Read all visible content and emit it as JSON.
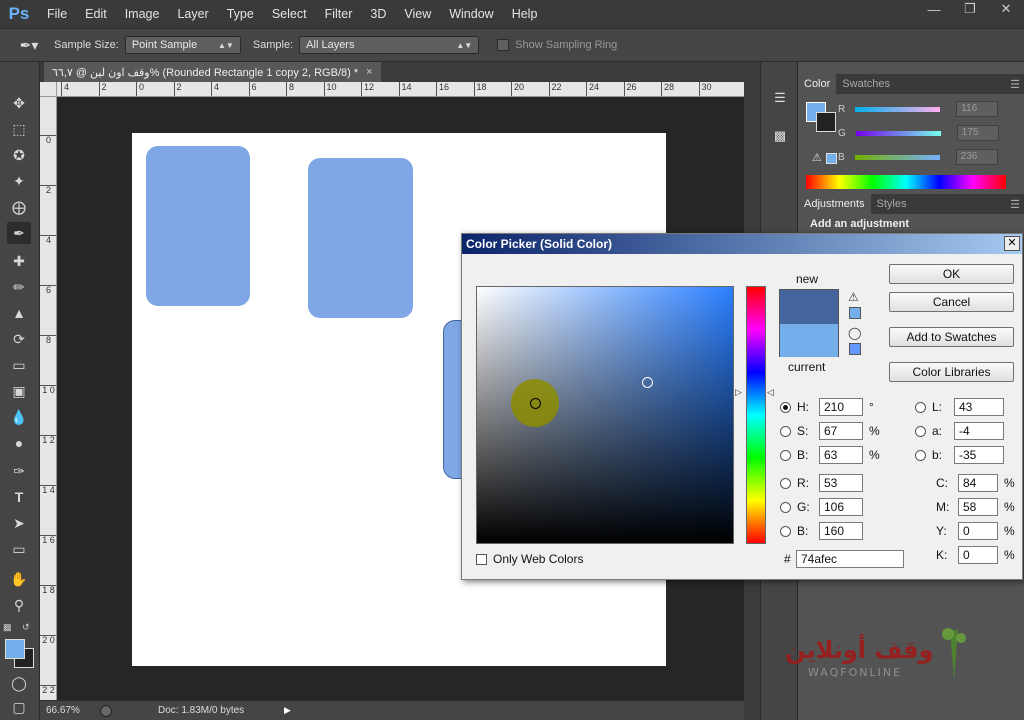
{
  "app": {
    "logo": "Ps",
    "menu": [
      "File",
      "Edit",
      "Image",
      "Layer",
      "Type",
      "Select",
      "Filter",
      "3D",
      "View",
      "Window",
      "Help"
    ]
  },
  "options_bar": {
    "sample_size_label": "Sample Size:",
    "sample_size_value": "Point Sample",
    "sample_label": "Sample:",
    "sample_value": "All Layers",
    "show_ring_label": "Show Sampling Ring"
  },
  "document": {
    "tab_title": "وقف اون لين @ ٦٦,٧% (Rounded Rectangle 1 copy 2, RGB/8) *",
    "ruler_h": [
      "4",
      "2",
      "0",
      "2",
      "4",
      "6",
      "8",
      "10",
      "12",
      "14",
      "16",
      "18",
      "20",
      "22",
      "24",
      "26",
      "28",
      "30"
    ],
    "ruler_v": [
      "0",
      "2",
      "4",
      "6",
      "8",
      "1 0",
      "1 2",
      "1 4",
      "1 6",
      "1 8",
      "2 0",
      "2 2"
    ],
    "shape_color": "#7fa7e6"
  },
  "status": {
    "zoom": "66.67%",
    "doc_info": "Doc: 1.83M/0 bytes"
  },
  "color_panel": {
    "tabs": [
      "Color",
      "Swatches"
    ],
    "channels": [
      {
        "label": "R",
        "value": "116"
      },
      {
        "label": "G",
        "value": "175"
      },
      {
        "label": "B",
        "value": "236"
      }
    ]
  },
  "adjustments_panel": {
    "tabs": [
      "Adjustments",
      "Styles"
    ],
    "heading": "Add an adjustment"
  },
  "color_picker": {
    "title": "Color Picker (Solid Color)",
    "new_label": "new",
    "current_label": "current",
    "new_color": "#44659e",
    "current_color": "#74afec",
    "buttons": {
      "ok": "OK",
      "cancel": "Cancel",
      "add_swatches": "Add to Swatches",
      "color_libraries": "Color Libraries"
    },
    "fields_left": [
      {
        "label": "H:",
        "value": "210",
        "unit": "°",
        "selected": true
      },
      {
        "label": "S:",
        "value": "67",
        "unit": "%",
        "selected": false
      },
      {
        "label": "B:",
        "value": "63",
        "unit": "%",
        "selected": false
      },
      {
        "label": "R:",
        "value": "53",
        "unit": "",
        "selected": false
      },
      {
        "label": "G:",
        "value": "106",
        "unit": "",
        "selected": false
      },
      {
        "label": "B:",
        "value": "160",
        "unit": "",
        "selected": false
      }
    ],
    "fields_lab": [
      {
        "label": "L:",
        "value": "43"
      },
      {
        "label": "a:",
        "value": "-4"
      },
      {
        "label": "b:",
        "value": "-35"
      }
    ],
    "fields_cmyk": [
      {
        "label": "C:",
        "value": "84",
        "unit": "%"
      },
      {
        "label": "M:",
        "value": "58",
        "unit": "%"
      },
      {
        "label": "Y:",
        "value": "0",
        "unit": "%"
      },
      {
        "label": "K:",
        "value": "0",
        "unit": "%"
      }
    ],
    "hex_label": "#",
    "hex_value": "74afec",
    "only_web_colors": "Only Web Colors"
  },
  "watermark": {
    "arabic": "وقف أونلاين",
    "latin": "WAQFONLINE"
  }
}
